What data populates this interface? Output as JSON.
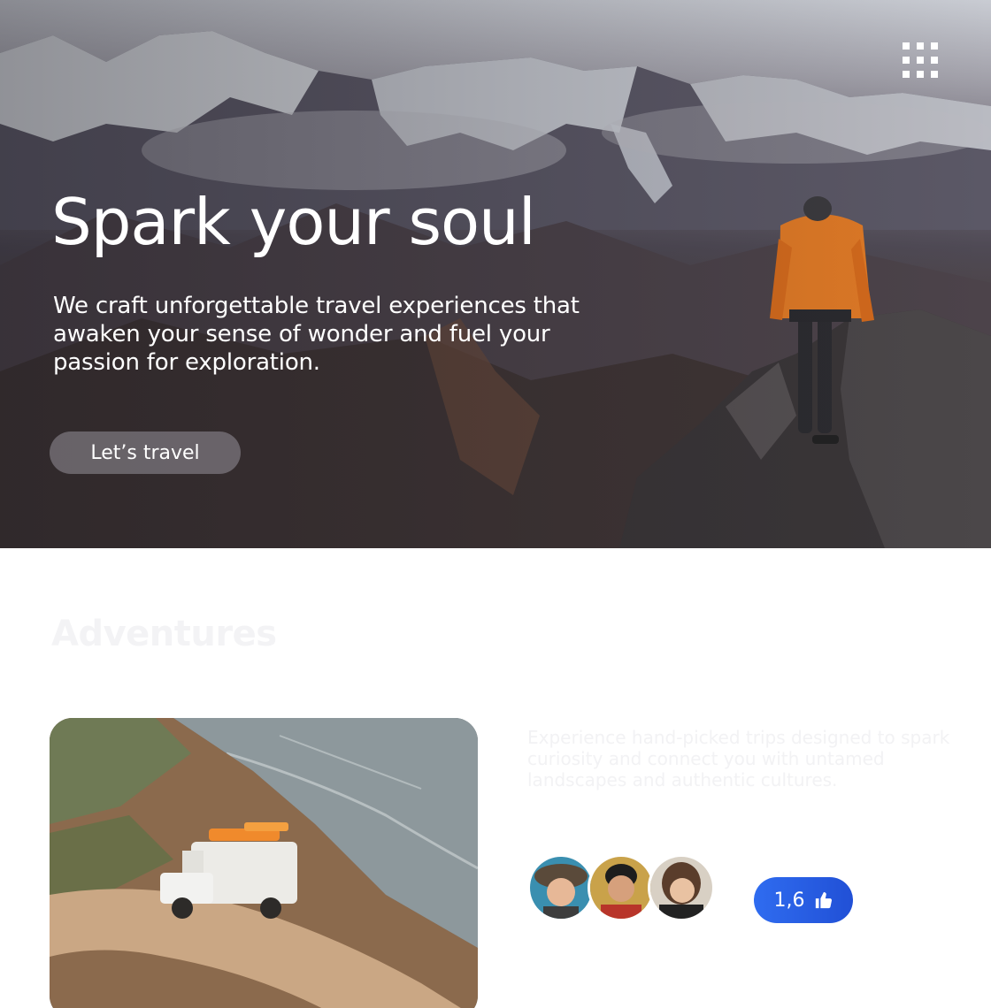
{
  "hero": {
    "title": "Spark your soul",
    "subtitle": "We craft unforgettable travel experiences that awaken your sense of wonder and fuel your passion for exploration.",
    "cta_label": "Let’s travel",
    "menu_icon": "grid-menu-icon"
  },
  "section": {
    "title": "Adventures",
    "description": "Experience hand-picked trips designed to spark curiosity and connect you with untamed landscapes and authentic cultures.",
    "likes": "1,6",
    "like_icon": "thumbs-up-icon",
    "accent_color": "#2f6cf0"
  }
}
